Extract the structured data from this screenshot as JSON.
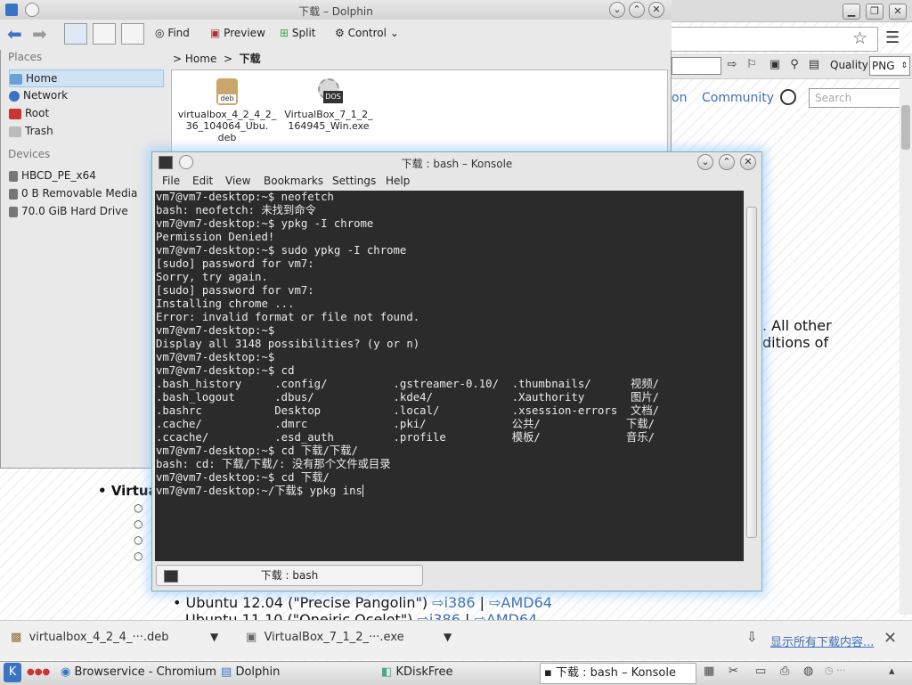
{
  "browser": {
    "search_placeholder": "Search",
    "nav_on": "on",
    "nav_community": "Community",
    "quality_label": "Quality",
    "quality_value": "PNG",
    "content_all_other": ". All other",
    "content_editions": "ditions of",
    "list_heading": "Virtua",
    "ubuntu_1204_text": "Ubuntu 12.04 (\"Precise Pangolin\")",
    "ubuntu_1110_text": "Ubuntu 11.10 (\"Oneiric Ocelot\")",
    "link_i386": "i386",
    "link_amd64": "AMD64",
    "link_sep": "|"
  },
  "downloads": {
    "item1": "virtualbox_4_2_4_···.deb",
    "item2": "VirtualBox_7_1_2_···.exe",
    "show_all": "显示所有下载内容..."
  },
  "taskbar": {
    "items": [
      "Browservice - Chromium",
      "Dolphin",
      "KDiskFree",
      "下载 : bash – Konsole"
    ]
  },
  "dolphin": {
    "title": "下载 – Dolphin",
    "toolbar": {
      "find": "Find",
      "preview": "Preview",
      "split": "Split",
      "control": "Control"
    },
    "places_heading": "Places",
    "places": [
      "Home",
      "Network",
      "Root",
      "Trash"
    ],
    "devices_heading": "Devices",
    "devices": [
      "HBCD_PE_x64",
      "0 B Removable Media",
      "70.0 GiB Hard Drive"
    ],
    "breadcrumb": {
      "home": "Home",
      "sep": ">",
      "current": "下载"
    },
    "files": [
      {
        "name_line1": "virtualbox_4_2_4_2_",
        "name_line2": "36_104064_Ubu.",
        "name_line3": "deb",
        "badge": "deb"
      },
      {
        "name_line1": "VirtualBox_7_1_2_",
        "name_line2": "164945_Win.exe",
        "name_line3": "",
        "badge": "DOS"
      }
    ]
  },
  "konsole": {
    "title": "下载 : bash – Konsole",
    "menu": [
      "File",
      "Edit",
      "View",
      "Bookmarks",
      "Settings",
      "Help"
    ],
    "tab_label": "下载 : bash",
    "lines": [
      "vm7@vm7-desktop:~$ neofetch",
      "bash: neofetch: 未找到命令",
      "vm7@vm7-desktop:~$ ypkg -I chrome",
      "Permission Denied!",
      "vm7@vm7-desktop:~$ sudo ypkg -I chrome",
      "[sudo] password for vm7:",
      "Sorry, try again.",
      "[sudo] password for vm7:",
      "Installing chrome ...",
      "Error: invalid format or file not found.",
      "vm7@vm7-desktop:~$",
      "Display all 3148 possibilities? (y or n)",
      "vm7@vm7-desktop:~$",
      "vm7@vm7-desktop:~$ cd",
      ".bash_history     .config/          .gstreamer-0.10/  .thumbnails/      视频/",
      ".bash_logout      .dbus/            .kde4/            .Xauthority       图片/",
      ".bashrc           Desktop           .local/           .xsession-errors  文档/",
      ".cache/           .dmrc             .pki/             公共/             下载/",
      ".ccache/          .esd_auth         .profile          模板/             音乐/",
      "vm7@vm7-desktop:~$ cd 下载/下载/",
      "bash: cd: 下载/下载/: 没有那个文件或目录",
      "vm7@vm7-desktop:~$ cd 下载/",
      "vm7@vm7-desktop:~/下载$ ypkg ins"
    ]
  }
}
